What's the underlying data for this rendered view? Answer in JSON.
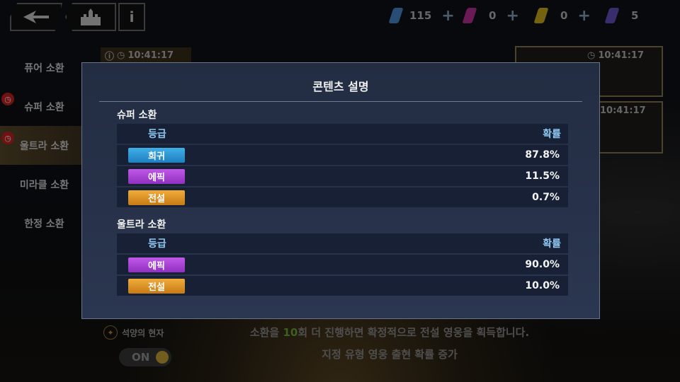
{
  "currencies": [
    {
      "icon": "blue-crystal-icon",
      "color": "#4a8fd6",
      "count": "115"
    },
    {
      "icon": "pink-crystal-icon",
      "color": "#c1319a",
      "count": "0"
    },
    {
      "icon": "gold-crystal-icon",
      "color": "#d6b21c",
      "count": "0"
    },
    {
      "icon": "purple-crystal-icon",
      "color": "#6a53c9",
      "count": "5"
    }
  ],
  "sidebar": {
    "items": [
      {
        "label": "퓨어 소환"
      },
      {
        "label": "슈퍼 소환"
      },
      {
        "label": "울트라 소환"
      },
      {
        "label": "미라클 소환"
      },
      {
        "label": "한정 소환"
      }
    ]
  },
  "timers": {
    "t1": "10:41:17",
    "t2": "10:41:17",
    "t3": "10:41:17"
  },
  "bottom": {
    "sunset_label": "석양의 현자",
    "toggle_label": "ON",
    "guarantee_prefix": "소환을 ",
    "guarantee_count": "10",
    "guarantee_suffix": "회 더 진행하면 확정적으로 전설 영웅을 획득합니다.",
    "rate_up": "지정 유형 영웅 출현 확률 증가"
  },
  "modal": {
    "title": "콘텐츠 설명",
    "grade_header": "등급",
    "rate_header": "확률",
    "sections": [
      {
        "title": "슈퍼 소환",
        "rows": [
          {
            "grade": "희귀",
            "rate": "87.8%",
            "color": "#1f8fd0"
          },
          {
            "grade": "에픽",
            "rate": "11.5%",
            "color": "#a23ad0"
          },
          {
            "grade": "전설",
            "rate": "0.7%",
            "color": "#d48a1c"
          }
        ]
      },
      {
        "title": "울트라 소환",
        "rows": [
          {
            "grade": "에픽",
            "rate": "90.0%",
            "color": "#a23ad0"
          },
          {
            "grade": "전설",
            "rate": "10.0%",
            "color": "#d48a1c"
          }
        ]
      }
    ]
  }
}
